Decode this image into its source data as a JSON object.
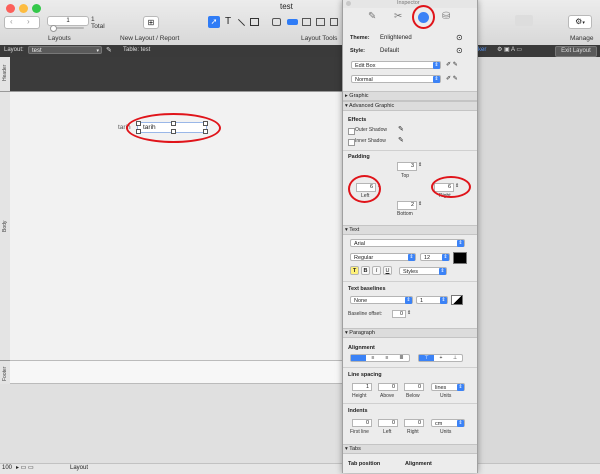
{
  "window": {
    "title": "test"
  },
  "toolbar": {
    "page_value": "1",
    "page_total_num": "1",
    "page_total_label": "Total",
    "layouts_label": "Layouts",
    "new_layout_label": "New Layout / Report",
    "layout_tools_label": "Layout Tools",
    "manage_label": "Manage"
  },
  "layout_bar": {
    "layout_label": "Layout:",
    "layout_value": "test",
    "table_label": "Table: test",
    "picker_label": "ker",
    "exit_button": "Exit Layout"
  },
  "parts": {
    "header": "Header",
    "body": "Body",
    "footer": "Footer"
  },
  "canvas": {
    "field_label": "tarih",
    "field_text": "tarih"
  },
  "inspector": {
    "title": "Inspector",
    "theme_label": "Theme:",
    "theme_value": "Enlightened",
    "style_label": "Style:",
    "style_value": "Default",
    "style_popup_1": "Edit Box",
    "style_popup_2": "Normal",
    "sections": {
      "graphic": "Graphic",
      "advanced_graphic": "Advanced Graphic",
      "text": "Text",
      "paragraph": "Paragraph",
      "tabs": "Tabs"
    },
    "effects": {
      "title": "Effects",
      "outer_shadow": "Outer Shadow",
      "inner_shadow": "Inner Shadow"
    },
    "padding": {
      "title": "Padding",
      "top": "3",
      "top_label": "Top",
      "left": "6",
      "left_label": "Left",
      "right": "6",
      "right_label": "Right",
      "bottom": "2",
      "bottom_label": "Bottom"
    },
    "text": {
      "font": "Arial",
      "style": "Regular",
      "size": "12",
      "styles_popup": "Styles",
      "baselines_title": "Text baselines",
      "baseline_none": "None",
      "baseline_num": "1",
      "baseline_offset_label": "Baseline offset:",
      "baseline_offset": "0"
    },
    "paragraph": {
      "alignment_title": "Alignment",
      "line_spacing_title": "Line spacing",
      "height": "1",
      "height_label": "Height",
      "above": "0",
      "above_label": "Above",
      "below": "0",
      "below_label": "Below",
      "units_lines": "lines",
      "units_label": "Units",
      "indents_title": "Indents",
      "first_line": "0",
      "first_line_label": "First line",
      "indent_left": "0",
      "indent_left_label": "Left",
      "indent_right": "0",
      "indent_right_label": "Right",
      "units_cm": "cm",
      "units_label2": "Units"
    },
    "tabs": {
      "position_label": "Tab position",
      "alignment_label": "Alignment"
    }
  },
  "statusbar": {
    "zoom": "100",
    "mode": "Layout"
  },
  "colors": {
    "accent": "#3b82f6",
    "highlight": "#e0141a"
  }
}
